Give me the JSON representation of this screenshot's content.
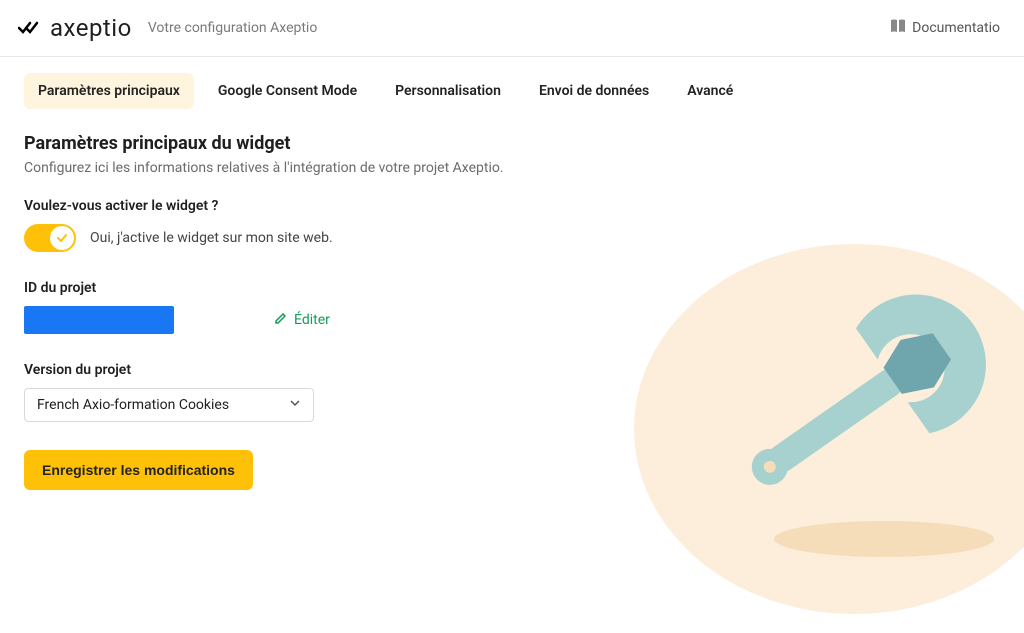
{
  "header": {
    "brand": "axeptio",
    "subtitle": "Votre configuration Axeptio",
    "doc_link": "Documentatio"
  },
  "tabs": [
    {
      "label": "Paramètres principaux",
      "active": true
    },
    {
      "label": "Google Consent Mode",
      "active": false
    },
    {
      "label": "Personnalisation",
      "active": false
    },
    {
      "label": "Envoi de données",
      "active": false
    },
    {
      "label": "Avancé",
      "active": false
    }
  ],
  "main": {
    "section_title": "Paramètres principaux du widget",
    "section_desc": "Configurez ici les informations relatives à l'intégration de votre projet Axeptio.",
    "activate_label": "Voulez-vous activer le widget ?",
    "activate_on_text": "Oui, j'active le widget sur mon site web.",
    "project_id_label": "ID du projet",
    "project_id_value": "",
    "edit_label": "Éditer",
    "version_label": "Version du projet",
    "version_selected": "French Axio-formation Cookies",
    "save_label": "Enregistrer les modifications"
  }
}
